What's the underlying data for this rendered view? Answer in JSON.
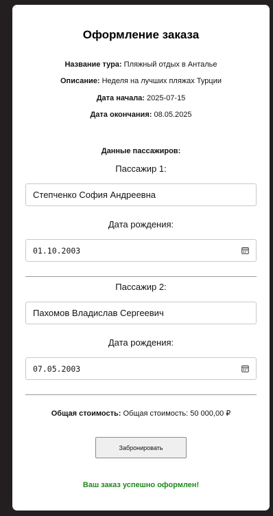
{
  "form": {
    "title": "Оформление заказа",
    "tour": {
      "label": "Название тура:",
      "value": "Пляжный отдых в Анталье"
    },
    "description": {
      "label": "Описание:",
      "value": "Неделя на лучших пляжах Турции"
    },
    "start_date": {
      "label": "Дата начала:",
      "value": "2025-07-15"
    },
    "end_date": {
      "label": "Дата окончания:",
      "value": "08.05.2025"
    }
  },
  "passengers": {
    "heading": "Данные пассажиров:",
    "items": [
      {
        "label": "Пассажир 1:",
        "name": "Степченко София Андреевна",
        "dob_label": "Дата рождения:",
        "dob": "01.10.2003"
      },
      {
        "label": "Пассажир 2:",
        "name": "Пахомов Владислав Сергеевич",
        "dob_label": "Дата рождения:",
        "dob": "07.05.2003"
      }
    ]
  },
  "total": {
    "label": "Общая стоимость:",
    "value": "Общая стоимость: 50 000,00 ₽"
  },
  "actions": {
    "book_label": "Забронировать"
  },
  "status": {
    "success_message": "Ваш заказ успешно оформлен!",
    "success_color": "#1e8a1e"
  },
  "icons": {
    "date_picker": "calendar-icon"
  }
}
